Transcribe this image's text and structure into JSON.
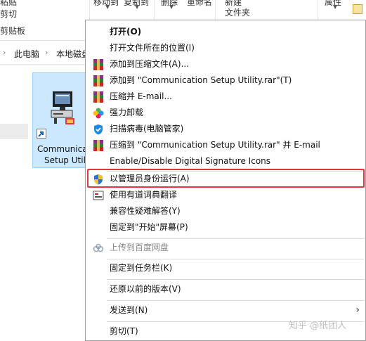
{
  "ribbon": {
    "clipboard_item_1": "粘贴",
    "clipboard_item_2": "剪切",
    "clipboard_group": "剪贴板",
    "organize_1": "移动到",
    "organize_2": "复制到",
    "organize_3": "删除",
    "organize_4": "重命名",
    "new_item": "新建",
    "new_group": "文件夹",
    "properties": "属性"
  },
  "address_bar": {
    "segments": [
      "此电脑",
      "本地磁盘"
    ]
  },
  "file": {
    "name_line1": "Communica",
    "name_line2": "Setup Utili"
  },
  "context_menu": {
    "items": [
      {
        "label": "打开(O)",
        "icon": "",
        "bold": true
      },
      {
        "label": "打开文件所在的位置(I)",
        "icon": ""
      },
      {
        "label": "添加到压缩文件(A)...",
        "icon": "winrar-icon"
      },
      {
        "label": "添加到 \"Communication Setup Utility.rar\"(T)",
        "icon": "winrar-icon"
      },
      {
        "label": "压缩并 E-mail...",
        "icon": "winrar-icon"
      },
      {
        "label": "强力卸载",
        "icon": "uninstall-flower-icon"
      },
      {
        "label": "扫描病毒(电脑管家)",
        "icon": "shield-scan-icon"
      },
      {
        "label": "压缩到 \"Communication Setup Utility.rar\" 并 E-mail",
        "icon": "winrar-icon"
      },
      {
        "label": "Enable/Disable Digital Signature Icons",
        "icon": ""
      },
      {
        "label": "以管理员身份运行(A)",
        "icon": "uac-shield-icon",
        "highlighted": true
      },
      {
        "label": "使用有道词典翻译",
        "icon": "youdao-icon"
      },
      {
        "label": "兼容性疑难解答(Y)",
        "icon": ""
      },
      {
        "label": "固定到\"开始\"屏幕(P)",
        "icon": ""
      },
      {
        "label": "上传到百度网盘",
        "icon": "baidu-cloud-icon",
        "disabled": true
      },
      {
        "label": "固定到任务栏(K)",
        "icon": ""
      },
      {
        "label": "还原以前的版本(V)",
        "icon": ""
      },
      {
        "label": "发送到(N)",
        "icon": "",
        "submenu": true
      },
      {
        "label": "剪切(T)",
        "icon": ""
      }
    ],
    "submenu_arrow": "›"
  },
  "watermark": "知乎 @纸团人",
  "colors": {
    "highlight_border": "#e0383e",
    "selection_fill": "#cce8ff",
    "selection_border": "#99d1ff"
  }
}
